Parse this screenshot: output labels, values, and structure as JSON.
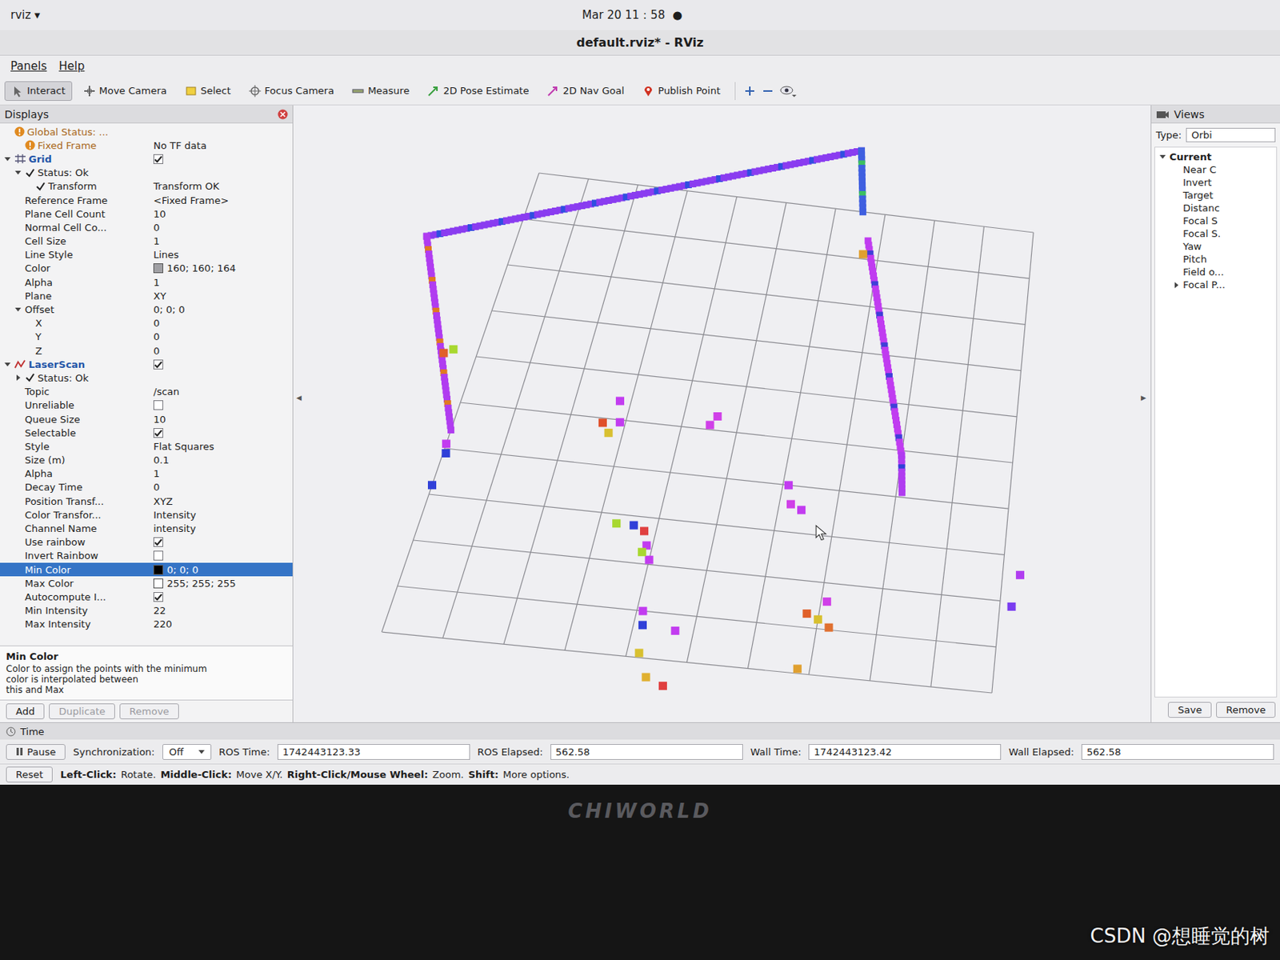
{
  "topbar": {
    "app": "rviz ▾",
    "clock": "Mar 20  11：58",
    "indicator": "●"
  },
  "window": {
    "title": "default.rviz* - RViz"
  },
  "menu": [
    "Panels",
    "Help"
  ],
  "tools": [
    {
      "label": "Interact",
      "selected": true
    },
    {
      "label": "Move Camera",
      "selected": false
    },
    {
      "label": "Select",
      "selected": false
    },
    {
      "label": "Focus Camera",
      "selected": false
    },
    {
      "label": "Measure",
      "selected": false
    },
    {
      "label": "2D Pose Estimate",
      "selected": false
    },
    {
      "label": "2D Nav Goal",
      "selected": false
    },
    {
      "label": "Publish Point",
      "selected": false
    }
  ],
  "displays": {
    "title": "Displays",
    "rows": [
      {
        "label": "Global Status: ...",
        "depth": 0,
        "kind": "warn",
        "selected": false
      },
      {
        "label": "Fixed Frame",
        "value": "No TF data",
        "depth": 1,
        "kind": "warn",
        "selected": false
      },
      {
        "label": "Grid",
        "depth": 0,
        "kind": "display",
        "expanded": true,
        "checked": true,
        "selected": false
      },
      {
        "label": "Status: Ok",
        "depth": 1,
        "kind": "status",
        "expanded": true,
        "selected": false
      },
      {
        "label": "Transform",
        "value": "Transform OK",
        "depth": 2,
        "kind": "status",
        "selected": false
      },
      {
        "label": "Reference Frame",
        "value": "<Fixed Frame>",
        "depth": 1,
        "kind": "prop",
        "selected": false
      },
      {
        "label": "Plane Cell Count",
        "value": "10",
        "depth": 1,
        "kind": "prop",
        "selected": false
      },
      {
        "label": "Normal Cell Co...",
        "value": "0",
        "depth": 1,
        "kind": "prop",
        "selected": false
      },
      {
        "label": "Cell Size",
        "value": "1",
        "depth": 1,
        "kind": "prop",
        "selected": false
      },
      {
        "label": "Line Style",
        "value": "Lines",
        "depth": 1,
        "kind": "prop",
        "selected": false
      },
      {
        "label": "Color",
        "value": "160; 160; 164",
        "depth": 1,
        "kind": "color",
        "color": "#a0a0a4",
        "selected": false
      },
      {
        "label": "Alpha",
        "value": "1",
        "depth": 1,
        "kind": "prop",
        "selected": false
      },
      {
        "label": "Plane",
        "value": "XY",
        "depth": 1,
        "kind": "prop",
        "selected": false
      },
      {
        "label": "Offset",
        "value": "0; 0; 0",
        "depth": 1,
        "kind": "prop",
        "expanded": true,
        "selected": false
      },
      {
        "label": "X",
        "value": "0",
        "depth": 2,
        "kind": "prop",
        "selected": false
      },
      {
        "label": "Y",
        "value": "0",
        "depth": 2,
        "kind": "prop",
        "selected": false
      },
      {
        "label": "Z",
        "value": "0",
        "depth": 2,
        "kind": "prop",
        "selected": false
      },
      {
        "label": "LaserScan",
        "depth": 0,
        "kind": "display",
        "expanded": true,
        "checked": true,
        "selected": false
      },
      {
        "label": "Status: Ok",
        "depth": 1,
        "kind": "status",
        "expanded": false,
        "selected": false
      },
      {
        "label": "Topic",
        "value": "/scan",
        "depth": 1,
        "kind": "prop",
        "selected": false
      },
      {
        "label": "Unreliable",
        "depth": 1,
        "kind": "check",
        "checked": false,
        "selected": false
      },
      {
        "label": "Queue Size",
        "value": "10",
        "depth": 1,
        "kind": "prop",
        "selected": false
      },
      {
        "label": "Selectable",
        "depth": 1,
        "kind": "check",
        "checked": true,
        "selected": false
      },
      {
        "label": "Style",
        "value": "Flat Squares",
        "depth": 1,
        "kind": "prop",
        "selected": false
      },
      {
        "label": "Size (m)",
        "value": "0.1",
        "depth": 1,
        "kind": "prop",
        "selected": false
      },
      {
        "label": "Alpha",
        "value": "1",
        "depth": 1,
        "kind": "prop",
        "selected": false
      },
      {
        "label": "Decay Time",
        "value": "0",
        "depth": 1,
        "kind": "prop",
        "selected": false
      },
      {
        "label": "Position Transf...",
        "value": "XYZ",
        "depth": 1,
        "kind": "prop",
        "selected": false
      },
      {
        "label": "Color Transfor...",
        "value": "Intensity",
        "depth": 1,
        "kind": "prop",
        "selected": false
      },
      {
        "label": "Channel Name",
        "value": "intensity",
        "depth": 1,
        "kind": "prop",
        "selected": false
      },
      {
        "label": "Use rainbow",
        "depth": 1,
        "kind": "check",
        "checked": true,
        "selected": false
      },
      {
        "label": "Invert Rainbow",
        "depth": 1,
        "kind": "check",
        "checked": false,
        "selected": false
      },
      {
        "label": "Min Color",
        "value": "0; 0; 0",
        "depth": 1,
        "kind": "color",
        "color": "#000000",
        "selected": true
      },
      {
        "label": "Max Color",
        "value": "255; 255; 255",
        "depth": 1,
        "kind": "color",
        "color": "#ffffff",
        "selected": false
      },
      {
        "label": "Autocompute I...",
        "depth": 1,
        "kind": "check",
        "checked": true,
        "selected": false
      },
      {
        "label": "Min Intensity",
        "value": "22",
        "depth": 1,
        "kind": "prop",
        "selected": false
      },
      {
        "label": "Max Intensity",
        "value": "220",
        "depth": 1,
        "kind": "prop",
        "selected": false
      }
    ],
    "description": {
      "title": "Min Color",
      "lines": [
        "Color to assign the points with the minimum",
        "color is interpolated between",
        "this and Max"
      ]
    },
    "buttons": [
      {
        "label": "Add",
        "disabled": false
      },
      {
        "label": "Duplicate",
        "disabled": true
      },
      {
        "label": "Remove",
        "disabled": true
      }
    ]
  },
  "viewport": {
    "left_handle": "◂",
    "right_handle": "▸",
    "walls": [
      {
        "from": [
          -1.7,
          1.6
        ],
        "to": [
          6.3,
          -1.3
        ],
        "color": "#8a3cf0",
        "accent": "#2f4fe0"
      },
      {
        "from": [
          6.3,
          -1.3
        ],
        "to": [
          6.55,
          0.0
        ],
        "color": "#3f5fe0",
        "accent": "#3cc060"
      },
      {
        "from": [
          6.75,
          0.6
        ],
        "to": [
          8.0,
          5.1
        ],
        "color": "#c03cf0",
        "accent": "#3f3fd8"
      },
      {
        "from": [
          8.0,
          5.1
        ],
        "to": [
          8.1,
          5.9
        ],
        "color": "#b03cf0",
        "accent": "#3040d8"
      },
      {
        "from": [
          -1.7,
          1.6
        ],
        "to": [
          0.0,
          5.6
        ],
        "color": "#b03cf0",
        "accent": "#e07a20"
      }
    ],
    "points": [
      {
        "at": [
          2.6,
          5.1
        ],
        "color": "#e0502a"
      },
      {
        "at": [
          2.75,
          5.3
        ],
        "color": "#d8c030"
      },
      {
        "at": [
          2.9,
          5.05
        ],
        "color": "#c23cf0"
      },
      {
        "at": [
          2.8,
          4.6
        ],
        "color": "#c23cf0"
      },
      {
        "at": [
          4.5,
          4.9
        ],
        "color": "#d040e8"
      },
      {
        "at": [
          4.6,
          4.7
        ],
        "color": "#d040e8"
      },
      {
        "at": [
          6.2,
          6.4
        ],
        "color": "#d040e8"
      },
      {
        "at": [
          6.4,
          6.5
        ],
        "color": "#c23cf0"
      },
      {
        "at": [
          6.1,
          6.0
        ],
        "color": "#c23cf0"
      },
      {
        "at": [
          3.3,
          7.2
        ],
        "color": "#a8d830"
      },
      {
        "at": [
          3.6,
          7.2
        ],
        "color": "#3040d8"
      },
      {
        "at": [
          3.8,
          7.3
        ],
        "color": "#e04040"
      },
      {
        "at": [
          3.9,
          7.6
        ],
        "color": "#c23cf0"
      },
      {
        "at": [
          4.0,
          7.9
        ],
        "color": "#c23cf0"
      },
      {
        "at": [
          3.85,
          7.75
        ],
        "color": "#a8d830"
      },
      {
        "at": [
          10.3,
          7.4
        ],
        "color": "#b03cf0"
      },
      {
        "at": [
          10.2,
          8.1
        ],
        "color": "#7a3cf0"
      },
      {
        "at": [
          7.1,
          8.4
        ],
        "color": "#d040e8"
      },
      {
        "at": [
          6.8,
          8.7
        ],
        "color": "#e0602a"
      },
      {
        "at": [
          7.0,
          8.8
        ],
        "color": "#d8c030"
      },
      {
        "at": [
          7.2,
          8.95
        ],
        "color": "#e07030"
      },
      {
        "at": [
          4.1,
          9.0
        ],
        "color": "#c23cf0"
      },
      {
        "at": [
          4.15,
          9.3
        ],
        "color": "#3040d8"
      },
      {
        "at": [
          4.7,
          9.35
        ],
        "color": "#c23cf0"
      },
      {
        "at": [
          4.2,
          9.9
        ],
        "color": "#d8c030"
      },
      {
        "at": [
          4.4,
          10.4
        ],
        "color": "#e0b030"
      },
      {
        "at": [
          4.7,
          10.55
        ],
        "color": "#e04040"
      },
      {
        "at": [
          6.8,
          9.9
        ],
        "color": "#e0a030"
      },
      {
        "at": [
          0.0,
          6.8
        ],
        "color": "#3040d8"
      },
      {
        "at": [
          -0.6,
          4.0
        ],
        "color": "#e0602a"
      },
      {
        "at": [
          -0.45,
          3.9
        ],
        "color": "#a8d830"
      },
      {
        "at": [
          6.7,
          0.9
        ],
        "color": "#e0a030"
      },
      {
        "at": [
          0.05,
          6.1
        ],
        "color": "#3040d8"
      },
      {
        "at": [
          0.0,
          5.9
        ],
        "color": "#c23cf0"
      }
    ]
  },
  "views": {
    "title": "Views",
    "type_label": "Type:",
    "type_value": "Orbi",
    "items": [
      {
        "label": "Current",
        "depth": 0,
        "expanded": true,
        "selected": false
      },
      {
        "label": "Near C",
        "depth": 1,
        "selected": false
      },
      {
        "label": "Invert",
        "depth": 1,
        "selected": false
      },
      {
        "label": "Target",
        "depth": 1,
        "selected": false
      },
      {
        "label": "Distanc",
        "depth": 1,
        "selected": false
      },
      {
        "label": "Focal S",
        "depth": 1,
        "selected": false
      },
      {
        "label": "Focal S.",
        "depth": 1,
        "selected": false
      },
      {
        "label": "Yaw",
        "depth": 1,
        "selected": false
      },
      {
        "label": "Pitch",
        "depth": 1,
        "selected": false
      },
      {
        "label": "Field o...",
        "depth": 1,
        "selected": false
      },
      {
        "label": "Focal P...",
        "depth": 1,
        "expanded": false,
        "selected": false
      }
    ],
    "buttons": [
      "Save",
      "Remove"
    ]
  },
  "time": {
    "title": "Time",
    "pause": "Pause",
    "sync_label": "Synchronization:",
    "sync_value": "Off",
    "fields": [
      {
        "label": "ROS Time:",
        "value": "1742443123.33"
      },
      {
        "label": "ROS Elapsed:",
        "value": "562.58"
      },
      {
        "label": "Wall Time:",
        "value": "1742443123.42"
      },
      {
        "label": "Wall Elapsed:",
        "value": "562.58"
      }
    ]
  },
  "status_bar": {
    "reset": "Reset",
    "hints": [
      {
        "key": "Left-Click:",
        "text": "Rotate."
      },
      {
        "key": "Middle-Click:",
        "text": "Move X/Y."
      },
      {
        "key": "Right-Click/Mouse Wheel:",
        "text": "Zoom."
      },
      {
        "key": "Shift:",
        "text": "More options."
      }
    ]
  },
  "monitor": {
    "brand": "CHIWORLD"
  },
  "watermark": "CSDN @想睡觉的树"
}
